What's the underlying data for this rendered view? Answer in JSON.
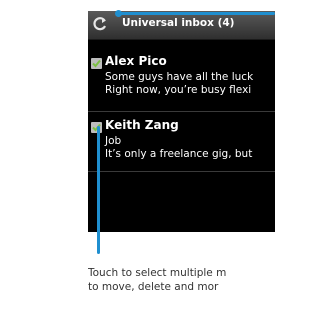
{
  "header": {
    "title": "Universal inbox (4)",
    "sync_icon": "sync-icon"
  },
  "messages": [
    {
      "selected": true,
      "sender": "Alex Pico",
      "line1": "Some guys have all the luck",
      "line2": "Right now, you’re busy flexi"
    },
    {
      "selected": true,
      "sender": "Keith Zang",
      "line1": "Job",
      "line2": "It’s only a freelance gig, but"
    }
  ],
  "caption": {
    "line1": "Touch to select multiple m",
    "line2": "to move, delete and mor"
  },
  "colors": {
    "callout": "#1f8fd0",
    "check": "#7cc043",
    "background": "#000000"
  }
}
